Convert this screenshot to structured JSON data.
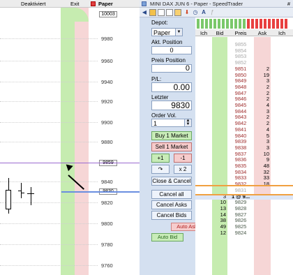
{
  "chart": {
    "header": {
      "deactivated": "Deaktiviert",
      "exit": "Exit",
      "paper": "Paper"
    },
    "price_labels": [
      "9980",
      "9960",
      "9940",
      "9920",
      "9900",
      "9880",
      "9840",
      "9820",
      "9800",
      "9780",
      "9760"
    ],
    "boxes": {
      "top": "10003",
      "mid": "9859",
      "low": "9830"
    },
    "colors": {
      "bid_band": "#c6ecb0",
      "ask_band": "#f6d6d6",
      "purple": "#9a6ad0",
      "blue": "#6a8ee0"
    }
  },
  "window": {
    "title": "MINI DAX JUN 6 - Paper - SpeedTrader",
    "hash": "#"
  },
  "toolbar": {
    "icons": [
      "arrow-left-icon",
      "settings-icon",
      "list-icon",
      "stop-icon",
      "lock-icon",
      "arrow-down-icon",
      "clock-icon",
      "font-icon",
      "formula-icon"
    ]
  },
  "controls": {
    "depot_label": "Depot:",
    "depot_value": "Paper",
    "position_label": "Akt. Position",
    "position_value": "0",
    "preis_position_label": "Preis Position",
    "preis_position_value": "0",
    "pl_label": "P/L:",
    "pl_value": "0.00",
    "letzter_label": "Letzter",
    "letzter_value": "9830",
    "order_vol_label": "Order Vol.",
    "order_vol_value": "1",
    "buy_btn": "Buy 1 Market",
    "sell_btn": "Sell 1 Market",
    "plus1": "+1",
    "minus1": "-1",
    "undo": "↷",
    "x2": "x 2",
    "close_cancel": "Close & Cancel",
    "cancel_all": "Cancel all",
    "cancel_asks": "Cancel Asks",
    "cancel_bids": "Cancel Bids",
    "auto_ask": "Auto Ask",
    "auto_bid": "Auto Bid"
  },
  "ladder": {
    "headers": {
      "ich": "Ich",
      "bid": "Bid",
      "preis": "Preis",
      "ask": "Ask",
      "ich2": "Ich"
    },
    "ask_rows": [
      {
        "price": "9855",
        "ask": ""
      },
      {
        "price": "9854",
        "ask": ""
      },
      {
        "price": "9853",
        "ask": ""
      },
      {
        "price": "9852",
        "ask": ""
      },
      {
        "price": "9851",
        "ask": "2"
      },
      {
        "price": "9850",
        "ask": "19"
      },
      {
        "price": "9849",
        "ask": "3"
      },
      {
        "price": "9848",
        "ask": "2"
      },
      {
        "price": "9847",
        "ask": "2"
      },
      {
        "price": "9846",
        "ask": "2"
      },
      {
        "price": "9845",
        "ask": "4"
      },
      {
        "price": "9844",
        "ask": "3"
      },
      {
        "price": "9843",
        "ask": "2"
      },
      {
        "price": "9842",
        "ask": "2"
      },
      {
        "price": "9841",
        "ask": "4"
      },
      {
        "price": "9840",
        "ask": "5"
      },
      {
        "price": "9839",
        "ask": "3"
      },
      {
        "price": "9838",
        "ask": "3"
      },
      {
        "price": "9837",
        "ask": "10"
      },
      {
        "price": "9836",
        "ask": "9"
      },
      {
        "price": "9835",
        "ask": "48"
      },
      {
        "price": "9834",
        "ask": "32"
      },
      {
        "price": "9833",
        "ask": "33"
      },
      {
        "price": "9832",
        "ask": "18"
      },
      {
        "price": "9831",
        "ask": ""
      }
    ],
    "last_trade": {
      "bid": "3",
      "price": "1 @ 9..."
    },
    "bid_rows": [
      {
        "price": "9829",
        "bid": "10"
      },
      {
        "price": "9828",
        "bid": "13"
      },
      {
        "price": "9827",
        "bid": "14"
      },
      {
        "price": "9826",
        "bid": "38"
      },
      {
        "price": "9825",
        "bid": "49"
      },
      {
        "price": "9824",
        "bid": "12"
      }
    ]
  }
}
